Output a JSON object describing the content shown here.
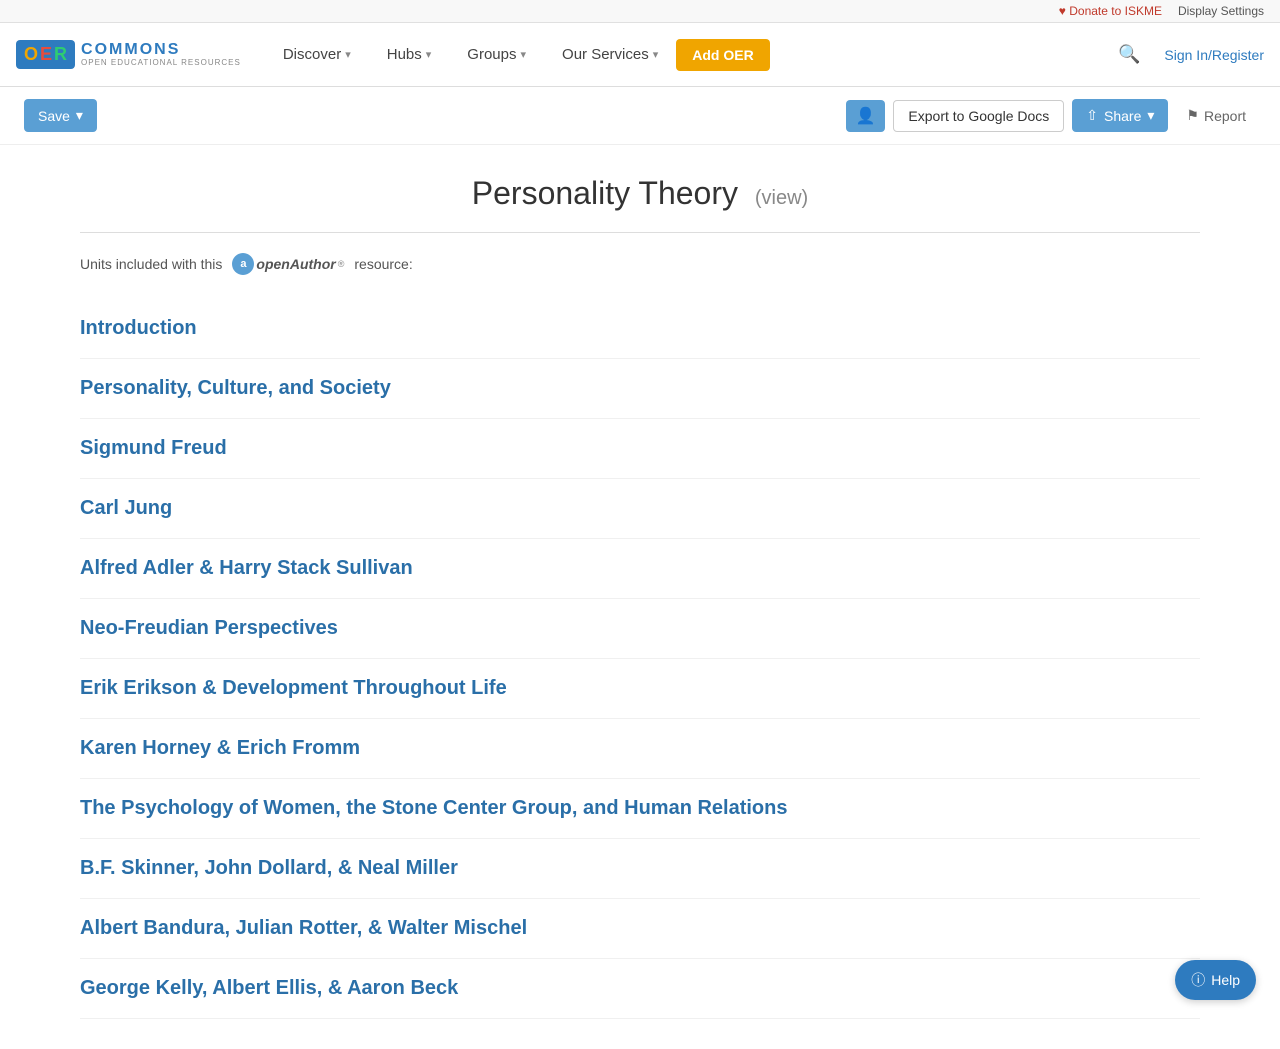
{
  "topbar": {
    "donate_label": "Donate to ISKME",
    "display_settings_label": "Display Settings"
  },
  "navbar": {
    "logo_o": "O",
    "logo_e": "E",
    "logo_r": "R",
    "logo_commons": "COMMONS",
    "logo_subtitle": "OPEN EDUCATIONAL RESOURCES",
    "discover_label": "Discover",
    "hubs_label": "Hubs",
    "groups_label": "Groups",
    "our_services_label": "Our Services",
    "add_oer_label": "Add OER",
    "signin_label": "Sign In/Register"
  },
  "actions": {
    "save_label": "Save",
    "export_label": "Export to Google Docs",
    "share_label": "Share",
    "report_label": "Report"
  },
  "page": {
    "title": "Personality Theory",
    "view_label": "(view)",
    "units_prefix": "Units included with this",
    "units_suffix": "resource:",
    "units": [
      {
        "label": "Introduction"
      },
      {
        "label": "Personality, Culture, and Society"
      },
      {
        "label": "Sigmund Freud"
      },
      {
        "label": "Carl Jung"
      },
      {
        "label": "Alfred Adler & Harry Stack Sullivan"
      },
      {
        "label": "Neo-Freudian Perspectives"
      },
      {
        "label": "Erik Erikson & Development Throughout Life"
      },
      {
        "label": "Karen Horney & Erich Fromm"
      },
      {
        "label": "The Psychology of Women, the Stone Center Group, and Human Relations"
      },
      {
        "label": "B.F. Skinner, John Dollard, & Neal Miller"
      },
      {
        "label": "Albert Bandura, Julian Rotter, & Walter Mischel"
      },
      {
        "label": "George Kelly, Albert Ellis, & Aaron Beck"
      }
    ]
  },
  "help": {
    "label": "Help"
  }
}
